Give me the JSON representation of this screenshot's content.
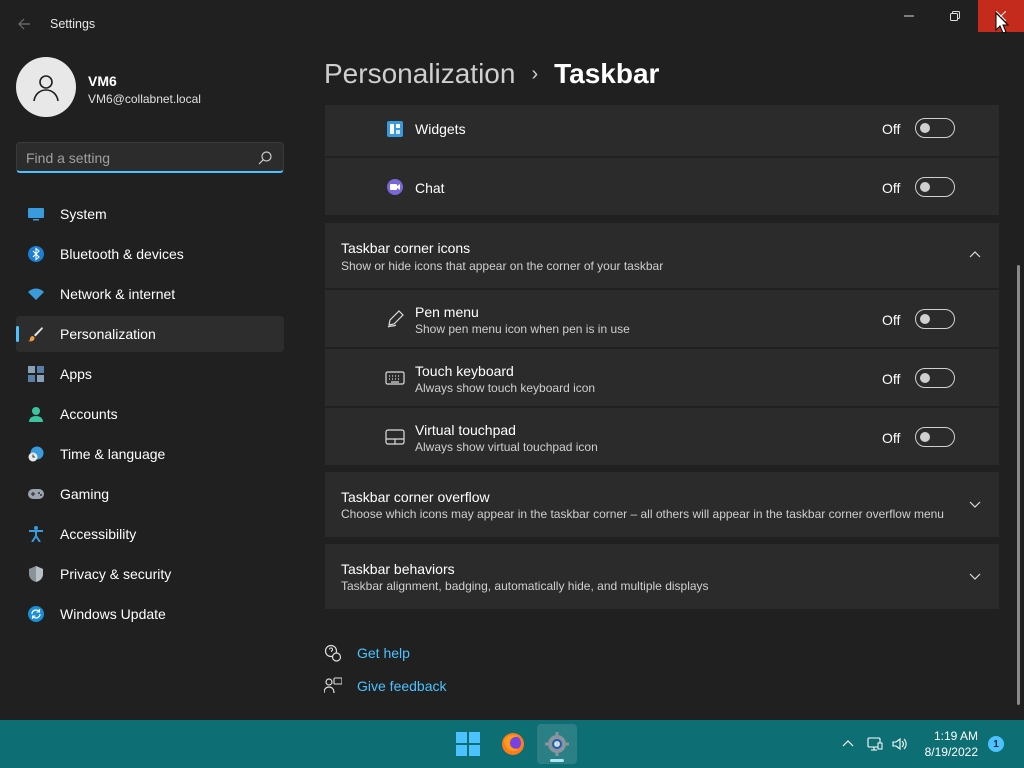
{
  "window": {
    "title": "Settings"
  },
  "colors": {
    "accent": "#4cc2ff",
    "taskbar": "#0d6f73",
    "close": "#c42b1c",
    "background": "#202020",
    "card": "#2b2b2b"
  },
  "user": {
    "name": "VM6",
    "email": "VM6@collabnet.local"
  },
  "search": {
    "placeholder": "Find a setting",
    "value": ""
  },
  "sidebar": {
    "items": [
      {
        "label": "System",
        "icon": "monitor-icon"
      },
      {
        "label": "Bluetooth & devices",
        "icon": "bluetooth-icon"
      },
      {
        "label": "Network & internet",
        "icon": "wifi-icon"
      },
      {
        "label": "Personalization",
        "icon": "brush-icon",
        "active": true
      },
      {
        "label": "Apps",
        "icon": "apps-icon"
      },
      {
        "label": "Accounts",
        "icon": "person-icon"
      },
      {
        "label": "Time & language",
        "icon": "clock-globe-icon"
      },
      {
        "label": "Gaming",
        "icon": "gamepad-icon"
      },
      {
        "label": "Accessibility",
        "icon": "accessibility-icon"
      },
      {
        "label": "Privacy & security",
        "icon": "shield-icon"
      },
      {
        "label": "Windows Update",
        "icon": "update-icon"
      }
    ]
  },
  "breadcrumb": {
    "parent": "Personalization",
    "separator": "›",
    "current": "Taskbar"
  },
  "taskbar_items": {
    "widgets": {
      "label": "Widgets",
      "state": "Off"
    },
    "chat": {
      "label": "Chat",
      "state": "Off"
    }
  },
  "corner_icons": {
    "title": "Taskbar corner icons",
    "subtitle": "Show or hide icons that appear on the corner of your taskbar",
    "items": [
      {
        "title": "Pen menu",
        "subtitle": "Show pen menu icon when pen is in use",
        "state": "Off"
      },
      {
        "title": "Touch keyboard",
        "subtitle": "Always show touch keyboard icon",
        "state": "Off"
      },
      {
        "title": "Virtual touchpad",
        "subtitle": "Always show virtual touchpad icon",
        "state": "Off"
      }
    ]
  },
  "corner_overflow": {
    "title": "Taskbar corner overflow",
    "subtitle": "Choose which icons may appear in the taskbar corner – all others will appear in the taskbar corner overflow menu"
  },
  "behaviors": {
    "title": "Taskbar behaviors",
    "subtitle": "Taskbar alignment, badging, automatically hide, and multiple displays"
  },
  "links": {
    "help": "Get help",
    "feedback": "Give feedback"
  },
  "system_taskbar": {
    "time": "1:19 AM",
    "date": "8/19/2022",
    "notifications": "1"
  }
}
